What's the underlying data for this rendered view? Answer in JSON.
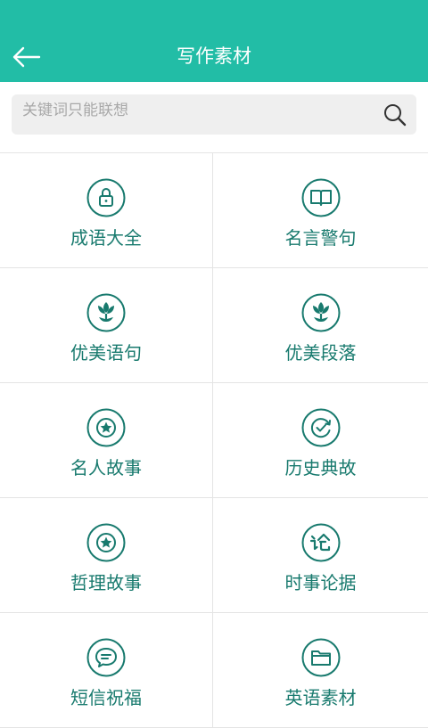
{
  "header": {
    "title": "写作素材"
  },
  "search": {
    "placeholder": "关键词只能联想"
  },
  "grid": {
    "items": [
      {
        "label": "成语大全"
      },
      {
        "label": "名言警句"
      },
      {
        "label": "优美语句"
      },
      {
        "label": "优美段落"
      },
      {
        "label": "名人故事"
      },
      {
        "label": "历史典故"
      },
      {
        "label": "哲理故事"
      },
      {
        "label": "时事论据"
      },
      {
        "label": "短信祝福"
      },
      {
        "label": "英语素材"
      }
    ]
  },
  "colors": {
    "header_bg": "#22bda6",
    "accent": "#187a6e"
  }
}
